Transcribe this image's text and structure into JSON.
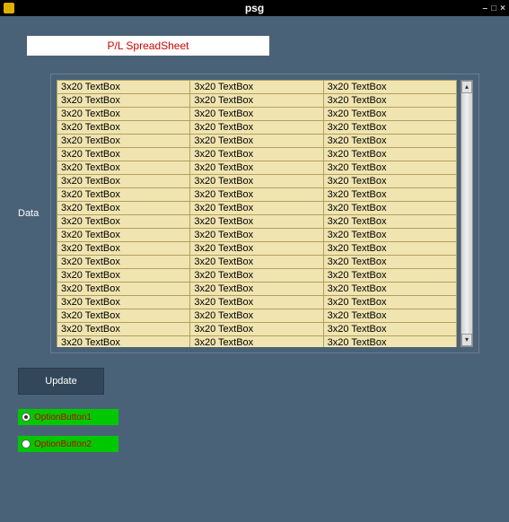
{
  "window": {
    "title": "psg",
    "minimize": "–",
    "maximize": "□",
    "close": "×"
  },
  "header": {
    "title": "P/L SpreadSheet"
  },
  "data_label": "Data",
  "grid": {
    "rows": 20,
    "cols": 3,
    "cell_text": "3x20 TextBox"
  },
  "buttons": {
    "update": "Update"
  },
  "radios": [
    {
      "label": "OptionButton1",
      "selected": true
    },
    {
      "label": "OptionButton2",
      "selected": false
    }
  ]
}
